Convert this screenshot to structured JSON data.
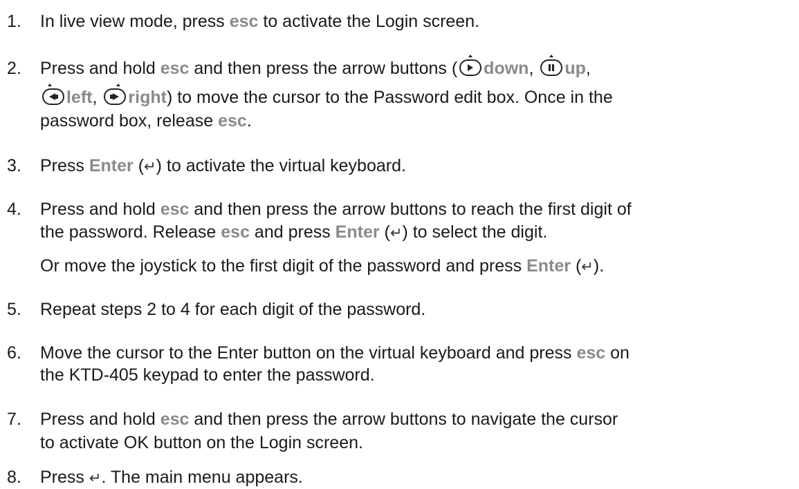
{
  "steps": [
    {
      "num": "1.",
      "a": "In live view mode, press ",
      "k1": "esc",
      "b": " to activate the Login screen."
    },
    {
      "num": "2.",
      "a": "Press and hold ",
      "k1": "esc",
      "b": " and then press the arrow buttons (",
      "down": "down",
      "sep1": ", ",
      "up": "up",
      "sep2": ",",
      "left": "left",
      "sep3": ", ",
      "right": "right",
      "c": ") to move the cursor to the Password edit box. Once in the",
      "d": "password box, release ",
      "k2": "esc",
      "e": "."
    },
    {
      "num": "3.",
      "a": "Press ",
      "k1": "Enter",
      "b": " (",
      "c": ") to activate the virtual keyboard."
    },
    {
      "num": "4.",
      "a": "Press and hold ",
      "k1": "esc",
      "b": " and then press the arrow buttons to reach the first digit of",
      "c": "the password. Release ",
      "k2": "esc",
      "d": " and press ",
      "k3": "Enter",
      "e": " (",
      "f": ") to select the digit.",
      "g": "Or move the joystick to the first digit of the password and press ",
      "k4": "Enter",
      "h": " (",
      "i": ")."
    },
    {
      "num": "5.",
      "a": "Repeat steps 2 to 4 for each digit of the password."
    },
    {
      "num": "6.",
      "a": "Move the cursor to the Enter button on the virtual keyboard and press ",
      "k1": "esc",
      "b": " on",
      "c": "the KTD-405 keypad to enter the password."
    },
    {
      "num": "7.",
      "a": "Press and hold ",
      "k1": "esc",
      "b": " and then press the arrow buttons to navigate the cursor",
      "c": "to activate OK button on the Login screen."
    },
    {
      "num": "8.",
      "a": "Press ",
      "b": ". The main menu appears."
    }
  ],
  "enter_symbol": "↵",
  "icons": {
    "down": "down-arrow-button-icon",
    "up": "up-arrow-button-icon",
    "left": "left-arrow-button-icon",
    "right": "right-arrow-button-icon"
  }
}
